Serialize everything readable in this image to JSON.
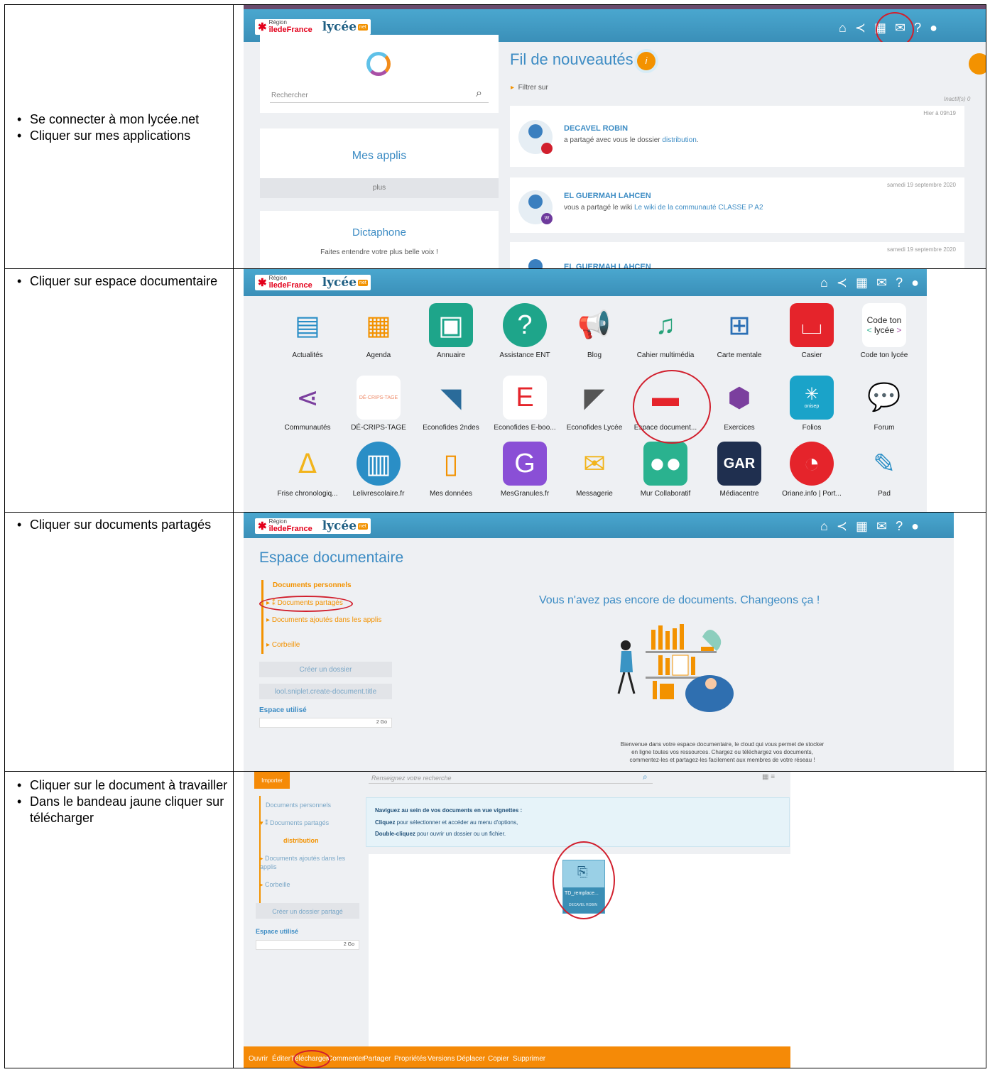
{
  "steps": [
    {
      "items": [
        "Se connecter à mon lycée.net",
        "Cliquer sur mes applications"
      ]
    },
    {
      "items": [
        "Cliquer sur espace documentaire"
      ]
    },
    {
      "items": [
        "Cliquer sur documents partagés"
      ]
    },
    {
      "items": [
        "Cliquer sur le document à travailler",
        "Dans le bandeau jaune cliquer sur télécharger"
      ]
    }
  ],
  "logo": {
    "region_small": "Région",
    "region": "îledeFrance",
    "brand": "lycée",
    "brand_small": "mon",
    "net": "net"
  },
  "nav_icons": [
    "home-icon",
    "share-icon",
    "apps-grid-icon",
    "mail-icon",
    "help-icon",
    "user-icon"
  ],
  "screen1": {
    "search_placeholder": "Rechercher",
    "mes_applis": "Mes applis",
    "plus": "plus",
    "dictaphone": "Dictaphone",
    "dictaphone_sub": "Faites entendre votre plus belle voix !",
    "feed_title": "Fil de nouveautés",
    "filter": "Filtrer sur",
    "inactive": "Inactif(s) 0",
    "feed": [
      {
        "time": "Hier à 09h19",
        "name": "DECAVEL ROBIN",
        "text": "a partagé avec vous le dossier ",
        "link": "distribution",
        "after": "."
      },
      {
        "time": "samedi 19 septembre 2020",
        "name": "EL GUERMAH LAHCEN",
        "text": "vous a partagé le wiki ",
        "link": "Le wiki de la communauté CLASSE P A2",
        "after": ""
      },
      {
        "time": "samedi 19 septembre 2020",
        "name": "EL GUERMAH LAHCEN",
        "text": "",
        "link": "",
        "after": ""
      }
    ]
  },
  "screen2": {
    "apps": [
      "Actualités",
      "Agenda",
      "Annuaire",
      "Assistance ENT",
      "Blog",
      "Cahier multimédia",
      "Carte mentale",
      "Casier",
      "Code ton lycée",
      "Communautés",
      "DÉ-CRIPS-TAGE",
      "Econofides 2ndes",
      "Econofides E-boo...",
      "Econofides Lycée",
      "Espace document...",
      "Exercices",
      "Folios",
      "Forum",
      "Frise chronologiq...",
      "Lelivrescolaire.fr",
      "Mes données",
      "MesGranules.fr",
      "Messagerie",
      "Mur Collaboratif",
      "Médiacentre",
      "Oriane.info | Port...",
      "Pad"
    ],
    "codeton_line1": "Code ton",
    "codeton_line2": "lycée",
    "decrips_label": "DÉ-CRIPS-TAGE",
    "gar": "GAR",
    "onisep": "onisep"
  },
  "screen3": {
    "title": "Espace documentaire",
    "tree": [
      "Documents personnels",
      "Documents partagés",
      "Documents ajoutés dans les applis",
      "Corbeille"
    ],
    "btn_create": "Créer un dossier",
    "btn_doc": "lool.sniplet.create-document.title",
    "used_label": "Espace utilisé",
    "quota": "2 Go",
    "empty_title": "Vous n'avez pas encore de documents. Changeons ça !",
    "welcome": [
      "Bienvenue dans votre espace documentaire, le cloud qui vous permet de stocker",
      "en ligne toutes vos ressources. Chargez ou téléchargez vos documents,",
      "commentez-les et partagez-les facilement aux membres de votre réseau !"
    ]
  },
  "screen4": {
    "import": "Importer",
    "search_placeholder": "Renseignez votre recherche",
    "tree": [
      "Documents personnels",
      "Documents partagés",
      "distribution",
      "Documents ajoutés dans les applis",
      "Corbeille"
    ],
    "btn_create": "Créer un dossier partagé",
    "used_label": "Espace utilisé",
    "quota": "2 Go",
    "tip_title": "Naviguez au sein de vos documents en vue vignettes :",
    "tip1_bold": "Cliquez",
    "tip1": " pour sélectionner et accéder au menu d'options,",
    "tip2_bold": "Double-cliquez",
    "tip2": " pour ouvrir un dossier ou un fichier.",
    "file_name": "TD_remplace...",
    "file_owner": "DECAVEL ROBIN",
    "actions": [
      "Ouvrir",
      "Éditer",
      "Télécharger",
      "Commenter",
      "Partager",
      "Propriétés",
      "Versions",
      "Déplacer",
      "Copier",
      "Supprimer"
    ]
  },
  "colors": {
    "ent_blue": "#3f9bc5",
    "orange": "#f58a07",
    "accent_red": "#d11f2d",
    "link_blue": "#3d8cc4"
  }
}
